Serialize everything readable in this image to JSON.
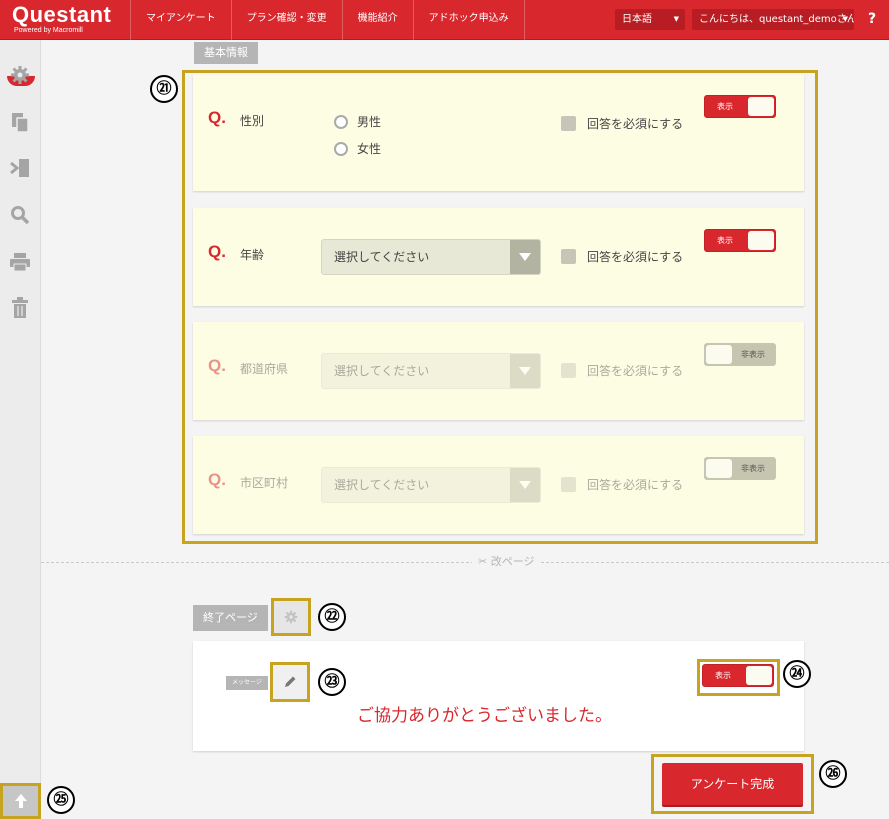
{
  "header": {
    "logo": "Questant",
    "logo_sub": "Powered by Macromill",
    "nav": [
      "マイアンケート",
      "プラン確認・変更",
      "機能紹介",
      "アドホック申込み"
    ],
    "language": "日本語",
    "user_greeting": "こんにちは、questant_demoさん",
    "help": "?"
  },
  "sidebar": {
    "icons": [
      "gear-icon",
      "copy-icon",
      "logic-icon",
      "search-icon",
      "print-icon",
      "trash-icon"
    ],
    "scroll_top_icon": "arrow-up-icon"
  },
  "section": {
    "label": "基本情報",
    "questions": [
      {
        "mark": "Q.",
        "title": "性別",
        "type": "radio",
        "options": [
          "男性",
          "女性"
        ],
        "required_label": "回答を必須にする",
        "toggle": "表示",
        "enabled": true
      },
      {
        "mark": "Q.",
        "title": "年齢",
        "type": "select",
        "placeholder": "選択してください",
        "required_label": "回答を必須にする",
        "toggle": "表示",
        "enabled": true
      },
      {
        "mark": "Q.",
        "title": "都道府県",
        "type": "select",
        "placeholder": "選択してください",
        "required_label": "回答を必須にする",
        "toggle": "非表示",
        "enabled": false
      },
      {
        "mark": "Q.",
        "title": "市区町村",
        "type": "select",
        "placeholder": "選択してください",
        "required_label": "回答を必須にする",
        "toggle": "非表示",
        "enabled": false
      }
    ]
  },
  "page_break": "改ページ",
  "end_page": {
    "label": "終了ページ",
    "message_tag": "メッセージ",
    "message": "ご協力ありがとうございました。",
    "toggle": "表示"
  },
  "complete_button": "アンケート完成",
  "annotations": [
    "㉑",
    "㉒",
    "㉓",
    "㉔",
    "㉕",
    "㉖"
  ],
  "colors": {
    "brand": "#d9272e",
    "highlight": "#c7a41f",
    "card_bg": "#fdfde4"
  }
}
